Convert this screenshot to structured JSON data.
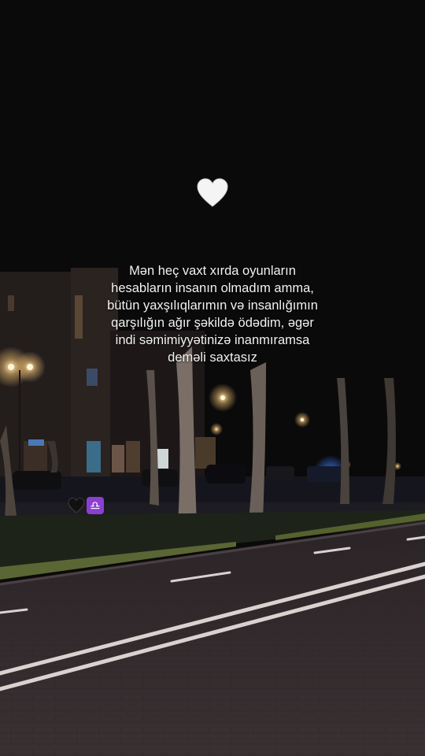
{
  "story": {
    "heart_icon": "white-heart-icon",
    "quote_lines": [
      "Mən heç vaxt xırda oyunların",
      "hesabların insanın olmadım amma,",
      "bütün yaxşılıqlarımın və insanlığımın",
      "qarşılığın ağır şəkildə ödədim, əgər",
      "indi səmimiyyətinizə inanmıramsa",
      "deməli saxtasız"
    ],
    "emojis": {
      "black_heart": "black-heart-icon",
      "libra_symbol": "♎"
    }
  },
  "colors": {
    "sky": "#0b0a0a",
    "street_light": "#ffd28a",
    "police_light": "#3f7bff",
    "libra_badge": "#8b3fd0"
  }
}
